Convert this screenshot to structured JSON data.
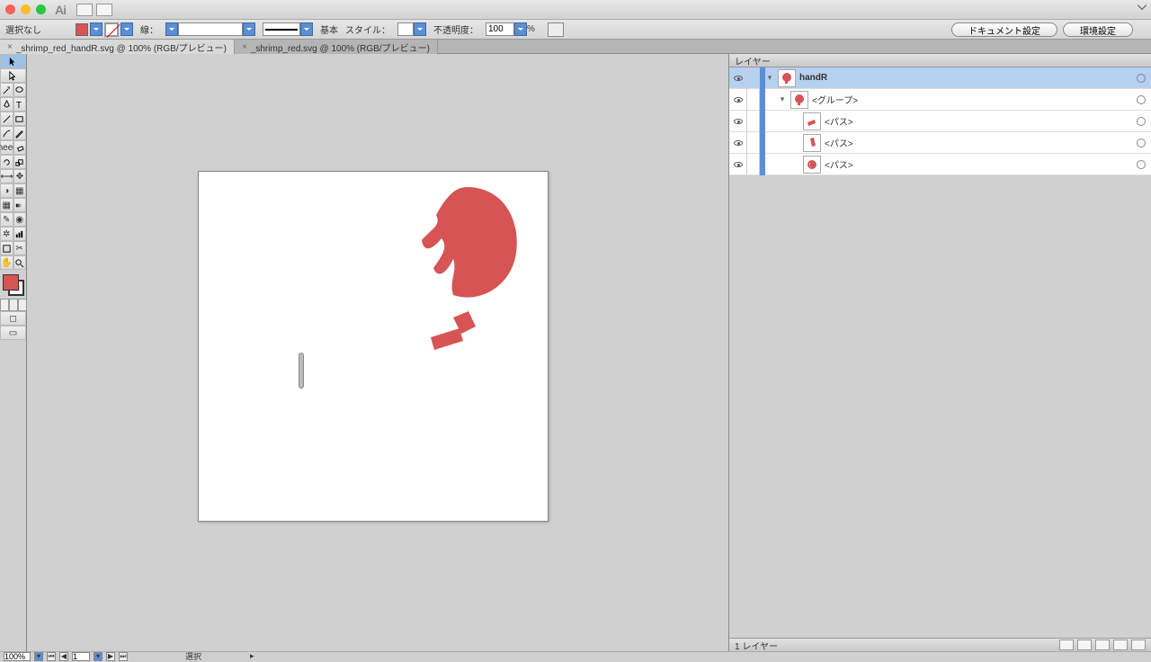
{
  "app": {
    "short_name": "Ai"
  },
  "control_bar": {
    "selection_label": "選択なし",
    "stroke_label": "線：",
    "stroke_weight": "",
    "stroke_cap_label": "基本",
    "style_label": "スタイル：",
    "opacity_label": "不透明度：",
    "opacity_value": "100",
    "opacity_unit": "%",
    "doc_setup_btn": "ドキュメント設定",
    "prefs_btn": "環境設定"
  },
  "tabs": [
    {
      "label": "_shrimp_red_handR.svg @ 100% (RGB/プレビュー)",
      "active": true
    },
    {
      "label": "_shrimp_red.svg @ 100% (RGB/プレビュー)",
      "active": false
    }
  ],
  "layers_panel": {
    "title": "レイヤー",
    "footer": "1 レイヤー",
    "items": [
      {
        "name": "handR",
        "indent": 0,
        "selected": true,
        "expanded": true,
        "thumb": "claw"
      },
      {
        "name": "<グループ>",
        "indent": 1,
        "selected": false,
        "expanded": true,
        "thumb": "claw"
      },
      {
        "name": "<パス>",
        "indent": 2,
        "selected": false,
        "thumb": "seg1"
      },
      {
        "name": "<パス>",
        "indent": 2,
        "selected": false,
        "thumb": "seg2"
      },
      {
        "name": "<パス>",
        "indent": 2,
        "selected": false,
        "thumb": "claw"
      }
    ]
  },
  "status": {
    "zoom": "100%",
    "page": "1",
    "sel_label": "選択"
  },
  "colors": {
    "accent": "#d75454"
  }
}
